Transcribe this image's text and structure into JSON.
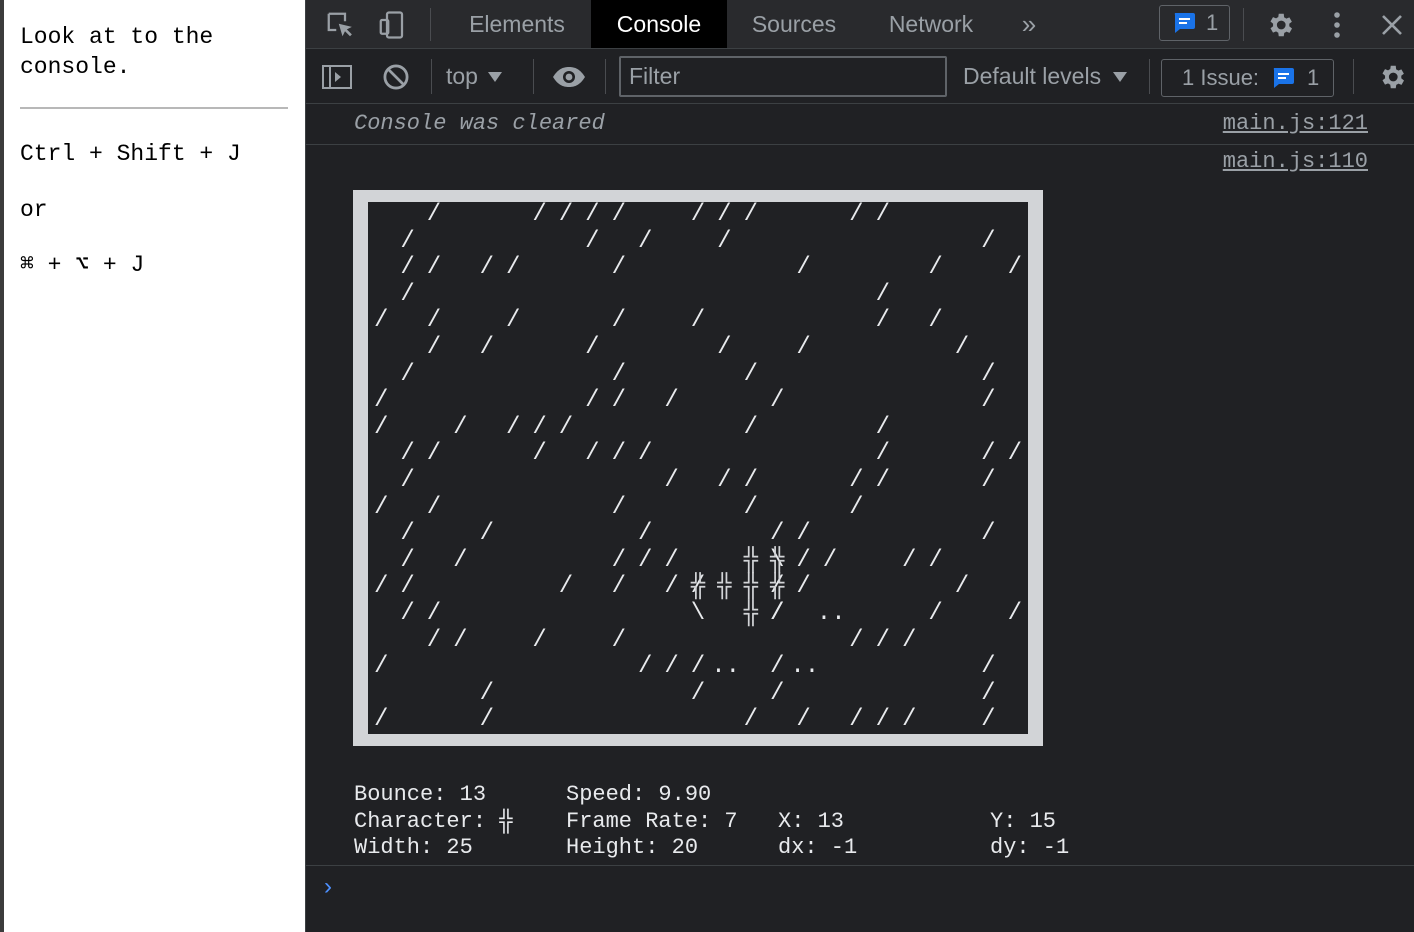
{
  "page": {
    "heading": "Look at to the console.",
    "shortcut_windows": "Ctrl + Shift + J",
    "shortcut_or": "or",
    "shortcut_mac": "⌘ + ⌥ + J"
  },
  "devtools": {
    "tabs": [
      {
        "label": "Elements",
        "active": false
      },
      {
        "label": "Console",
        "active": true
      },
      {
        "label": "Sources",
        "active": false
      },
      {
        "label": "Network",
        "active": false
      }
    ],
    "more_tabs_glyph": "»",
    "messages_badge_count": "1",
    "toolbar": {
      "context": "top",
      "filter_placeholder": "Filter",
      "levels": "Default levels",
      "issues_label": "1 Issue:",
      "issues_count": "1"
    },
    "colors": {
      "accent_blue": "#1a73e8",
      "panel_bg": "#202124",
      "active_tab": "#000000"
    }
  },
  "console": {
    "cleared_text": "Console was cleared",
    "cleared_source": "main.js:121",
    "game_source": "main.js:110",
    "game": {
      "width": 25,
      "height": 20,
      "rain_char": "/",
      "rain": [
        [
          2,
          6,
          7,
          8,
          9,
          12,
          13,
          14,
          18,
          19
        ],
        [
          1,
          8,
          10,
          13,
          23
        ],
        [
          1,
          2,
          4,
          5,
          9,
          16,
          21,
          24
        ],
        [
          1,
          19
        ],
        [
          0,
          2,
          5,
          9,
          12,
          19,
          21
        ],
        [
          2,
          4,
          8,
          13,
          16,
          22
        ],
        [
          1,
          9,
          14,
          23
        ],
        [
          0,
          8,
          9,
          11,
          15,
          23
        ],
        [
          0,
          3,
          5,
          6,
          7,
          14,
          19
        ],
        [
          1,
          2,
          6,
          8,
          9,
          10,
          19,
          23,
          24
        ],
        [
          1,
          11,
          13,
          14,
          18,
          19,
          23
        ],
        [
          0,
          2,
          9,
          14,
          18
        ],
        [
          1,
          4,
          10,
          15,
          16,
          23
        ],
        [
          1,
          3,
          9,
          10,
          11,
          16,
          17,
          20,
          21
        ],
        [
          0,
          1,
          7,
          9,
          11,
          12,
          16,
          22
        ],
        [
          1,
          2,
          15,
          21,
          24
        ],
        [
          2,
          3,
          6,
          9,
          18,
          19,
          20
        ],
        [
          0,
          10,
          11,
          12,
          15,
          23
        ],
        [
          4,
          12,
          15,
          23
        ],
        [
          0,
          4,
          14,
          16,
          18,
          19,
          20,
          23
        ]
      ],
      "dots": [
        [
          15,
          17
        ],
        [
          17,
          13
        ],
        [
          17,
          16
        ]
      ],
      "dots_char": "..",
      "ball": {
        "char": "╬",
        "cells": [
          [
            13,
            14
          ],
          [
            14,
            13
          ],
          [
            14,
            14
          ],
          [
            14,
            15
          ],
          [
            15,
            14
          ],
          [
            13,
            15
          ],
          [
            14,
            12
          ]
        ],
        "trail_backslash": [
          [
            13,
            15
          ],
          [
            15,
            12
          ]
        ],
        "trail_slash": [
          [
            14,
            15
          ],
          [
            15,
            15
          ]
        ]
      }
    },
    "stats": {
      "bounce": "Bounce: 13",
      "speed": "Speed: 9.90",
      "character": "Character: ╬",
      "frame_rate": "Frame Rate: 7",
      "x": "X: 13",
      "y": "Y: 15",
      "width": "Width: 25",
      "height": "Height: 20",
      "dx": "dx: -1",
      "dy": "dy: -1"
    },
    "prompt_glyph": "›"
  }
}
